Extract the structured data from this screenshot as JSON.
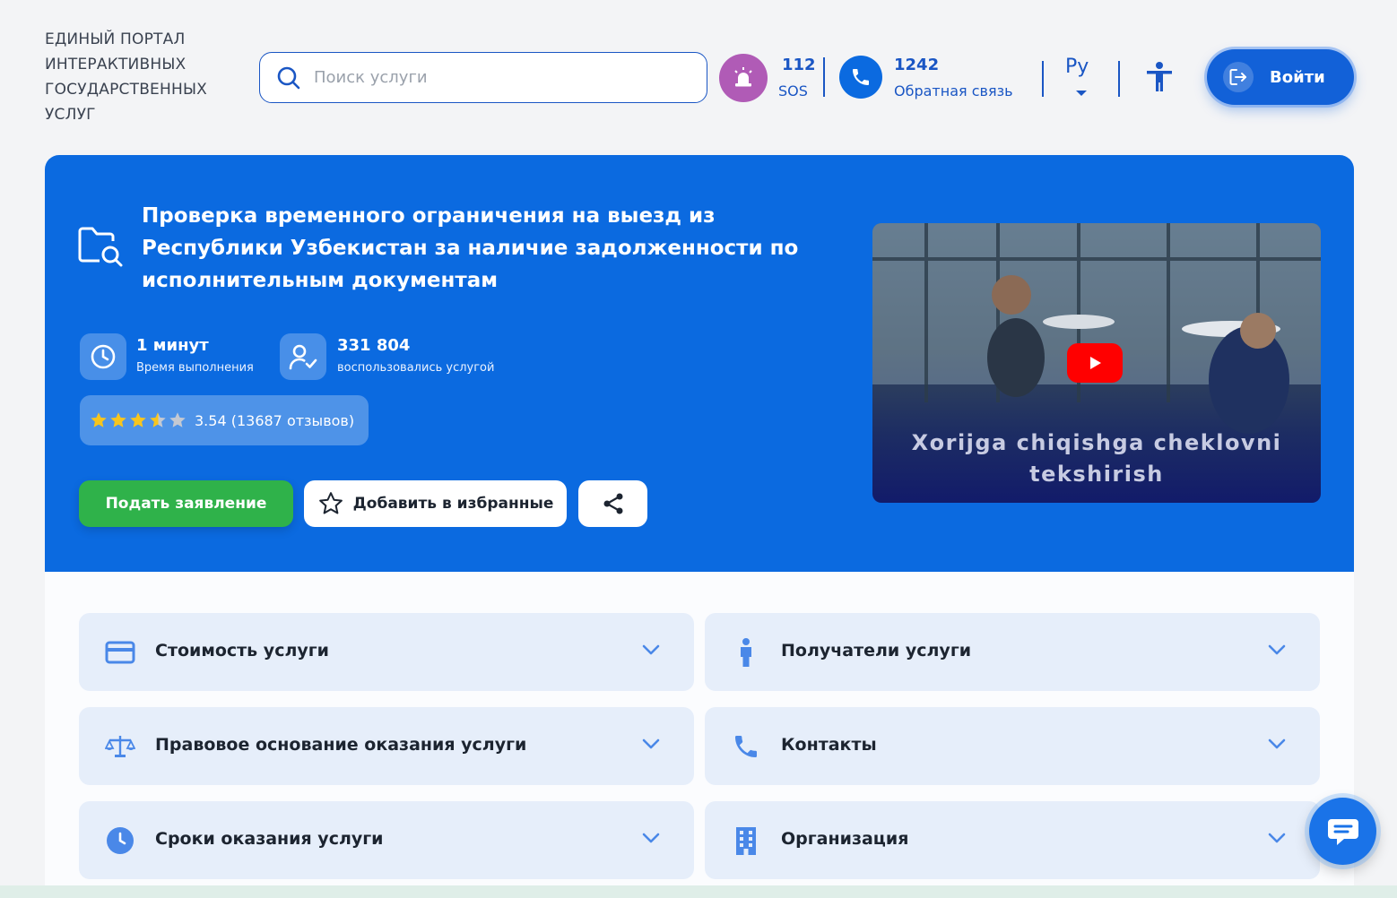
{
  "header": {
    "portal_title": "ЕДИНЫЙ ПОРТАЛ ИНТЕРАКТИВНЫХ ГОСУДАРСТВЕННЫХ УСЛУГ",
    "search_placeholder": "Поиск услуги",
    "sos_number": "112",
    "sos_label": "SOS",
    "hotline_number": "1242",
    "hotline_label": "Обратная связь",
    "language": "Ру",
    "login_label": "Войти"
  },
  "service": {
    "title": "Проверка временного ограничения на выезд из Республики Узбекистан за наличие задолженности по исполнительным документам",
    "duration_value": "1 минут",
    "duration_label": "Время выполнения",
    "users_value": "331 804",
    "users_label": "воспользовались услугой",
    "rating_text": "3.54 (13687 отзывов)",
    "rating_value": 3.54,
    "rating_max": 5,
    "apply_label": "Подать заявление",
    "favorite_label": "Добавить в избранные",
    "video_caption": "Xorijga chiqishga cheklovni tekshirish"
  },
  "accordion": [
    {
      "label": "Стоимость услуги",
      "icon": "credit-card-icon"
    },
    {
      "label": "Получатели услуги",
      "icon": "person-icon"
    },
    {
      "label": "Правовое основание оказания услуги",
      "icon": "scales-icon"
    },
    {
      "label": "Контакты",
      "icon": "phone-icon"
    },
    {
      "label": "Сроки оказания услуги",
      "icon": "clock-icon"
    },
    {
      "label": "Организация",
      "icon": "building-icon"
    }
  ],
  "colors": {
    "primary": "#0b6ae0",
    "accent_green": "#2fb24a",
    "sos_purple": "#b05bb6",
    "accordion_bg": "#e6eefa",
    "icon_blue": "#4a88e8"
  }
}
